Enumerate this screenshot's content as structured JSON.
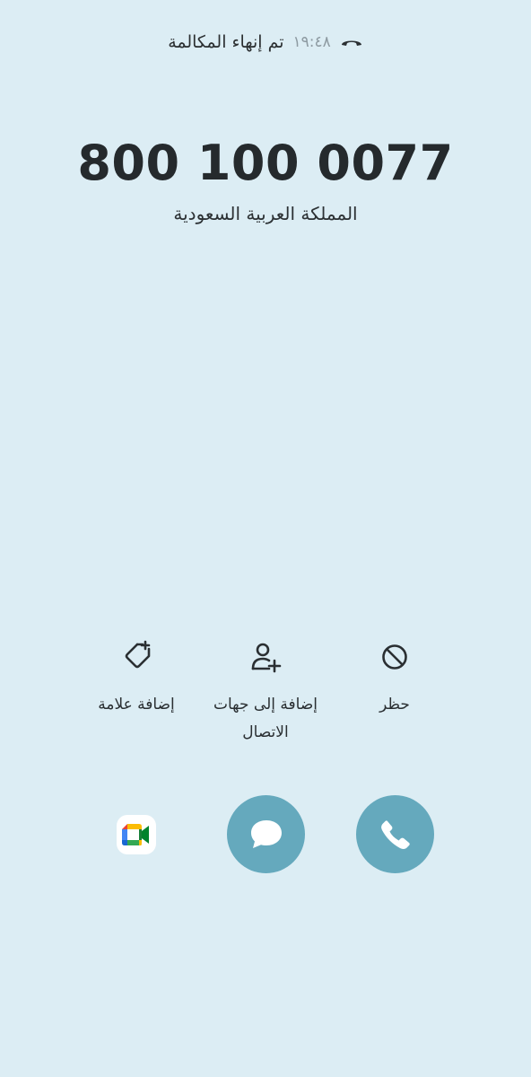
{
  "status": {
    "text": "تم إنهاء المكالمة",
    "time": "١٩:٤٨",
    "icon": "end-call-icon"
  },
  "caller": {
    "number": "800 100 0077",
    "country": "المملكة العربية السعودية"
  },
  "actions": {
    "add_tag": {
      "label": "إضافة علامة",
      "icon": "tag-add-icon"
    },
    "add_contact": {
      "label": "إضافة إلى جهات\nالاتصال",
      "icon": "person-add-icon"
    },
    "block": {
      "label": "حظر",
      "icon": "block-icon"
    }
  },
  "call_buttons": {
    "meet": {
      "icon": "google-meet-icon"
    },
    "message": {
      "icon": "message-icon"
    },
    "call": {
      "icon": "phone-icon"
    }
  },
  "colors": {
    "background": "#dcedf4",
    "button": "#65a9bd",
    "text": "#252a2d"
  }
}
